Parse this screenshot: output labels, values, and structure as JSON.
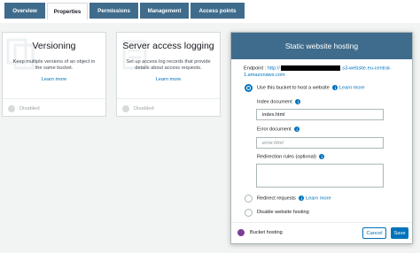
{
  "tabs": [
    {
      "label": "Overview",
      "active": false
    },
    {
      "label": "Properties",
      "active": true
    },
    {
      "label": "Permissions",
      "active": false
    },
    {
      "label": "Management",
      "active": false
    },
    {
      "label": "Access points",
      "active": false
    }
  ],
  "cards": {
    "versioning": {
      "title": "Versioning",
      "description": "Keep multiple versions of an object in the same bucket.",
      "link": "Learn more",
      "status": "Disabled"
    },
    "logging": {
      "title": "Server access logging",
      "description": "Set up access log records that provide details about access requests.",
      "link": "Learn more",
      "status": "Disabled"
    }
  },
  "modal": {
    "title": "Static website hosting",
    "endpoint_label": "Endpoint : ",
    "endpoint_prefix": "http://",
    "endpoint_suffix": ".s3-website.eu-central-1.amazonaws.com",
    "options": {
      "host": {
        "label": "Use this bucket to host a website",
        "link": "Learn more",
        "selected": true
      },
      "redirect": {
        "label": "Redirect requests",
        "link": "Learn more",
        "selected": false
      },
      "disable": {
        "label": "Disable website hosting",
        "selected": false
      }
    },
    "index_document": {
      "label": "Index document",
      "value": "index.html"
    },
    "error_document": {
      "label": "Error document",
      "placeholder": "error.html"
    },
    "redirection_rules": {
      "label": "Redirection rules (optional)"
    },
    "footer": {
      "status_label": "Bucket hosting",
      "cancel_label": "Cancel",
      "save_label": "Save"
    }
  },
  "colors": {
    "tab_bg": "#3f6c8c",
    "accent": "#0073bb",
    "enabled_dot": "#7b3f98"
  }
}
